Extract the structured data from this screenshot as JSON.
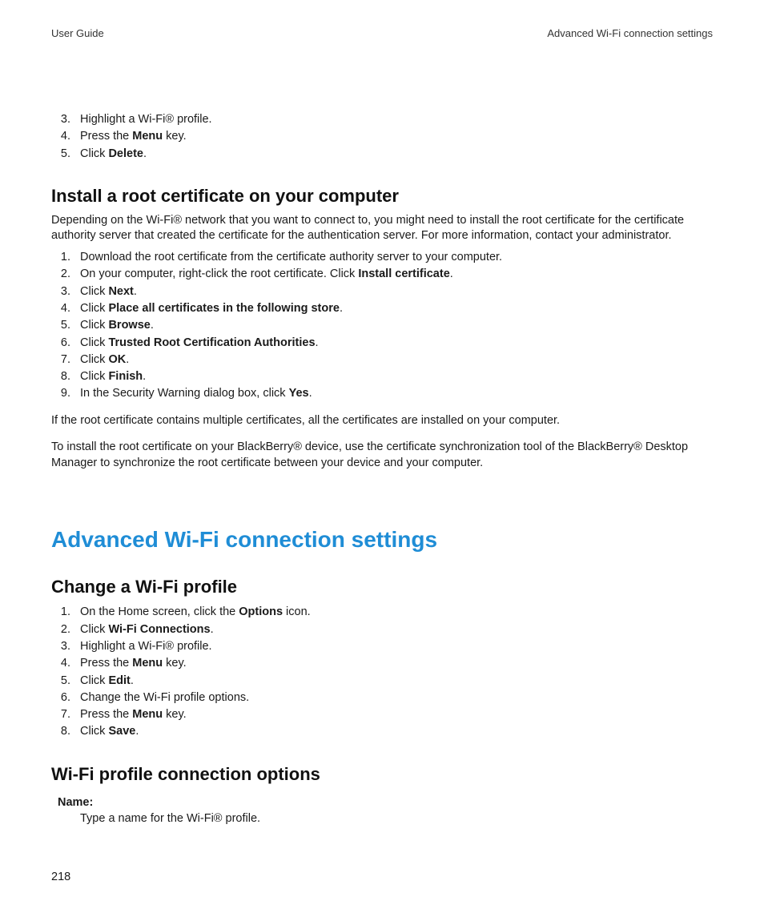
{
  "header": {
    "left": "User Guide",
    "right": "Advanced Wi-Fi connection settings"
  },
  "topList": {
    "start": 3,
    "items": [
      {
        "html": "Highlight a Wi-Fi® profile."
      },
      {
        "html": "Press the <b>Menu</b> key."
      },
      {
        "html": "Click <b>Delete</b>."
      }
    ]
  },
  "section1": {
    "title": "Install a root certificate on your computer",
    "intro": "Depending on the Wi-Fi® network that you want to connect to, you might need to install the root certificate for the certificate authority server that created the certificate for the authentication server. For more information, contact your administrator.",
    "steps": [
      {
        "html": "Download the root certificate from the certificate authority server to your computer."
      },
      {
        "html": "On your computer, right-click the root certificate. Click <b>Install certificate</b>."
      },
      {
        "html": "Click <b>Next</b>."
      },
      {
        "html": "Click <b>Place all certificates in the following store</b>."
      },
      {
        "html": "Click <b>Browse</b>."
      },
      {
        "html": "Click <b>Trusted Root Certification Authorities</b>."
      },
      {
        "html": "Click <b>OK</b>."
      },
      {
        "html": "Click <b>Finish</b>."
      },
      {
        "html": "In the Security Warning dialog box, click <b>Yes</b>."
      }
    ],
    "note1": "If the root certificate contains multiple certificates, all the certificates are installed on your computer.",
    "note2": "To install the root certificate on your BlackBerry® device, use the certificate synchronization tool of the BlackBerry® Desktop Manager to synchronize the root certificate between your device and your computer."
  },
  "mainTitle": "Advanced Wi-Fi connection settings",
  "section2": {
    "title": "Change a Wi-Fi profile",
    "steps": [
      {
        "html": "On the Home screen, click the <b>Options</b> icon."
      },
      {
        "html": "Click <b>Wi-Fi Connections</b>."
      },
      {
        "html": "Highlight a Wi-Fi® profile."
      },
      {
        "html": "Press the <b>Menu</b> key."
      },
      {
        "html": "Click <b>Edit</b>."
      },
      {
        "html": "Change the Wi-Fi profile options."
      },
      {
        "html": "Press the <b>Menu</b> key."
      },
      {
        "html": "Click <b>Save</b>."
      }
    ]
  },
  "section3": {
    "title": "Wi-Fi profile connection options",
    "def": {
      "term": "Name:",
      "desc": "Type a name for the Wi-Fi® profile."
    }
  },
  "pageNumber": "218"
}
